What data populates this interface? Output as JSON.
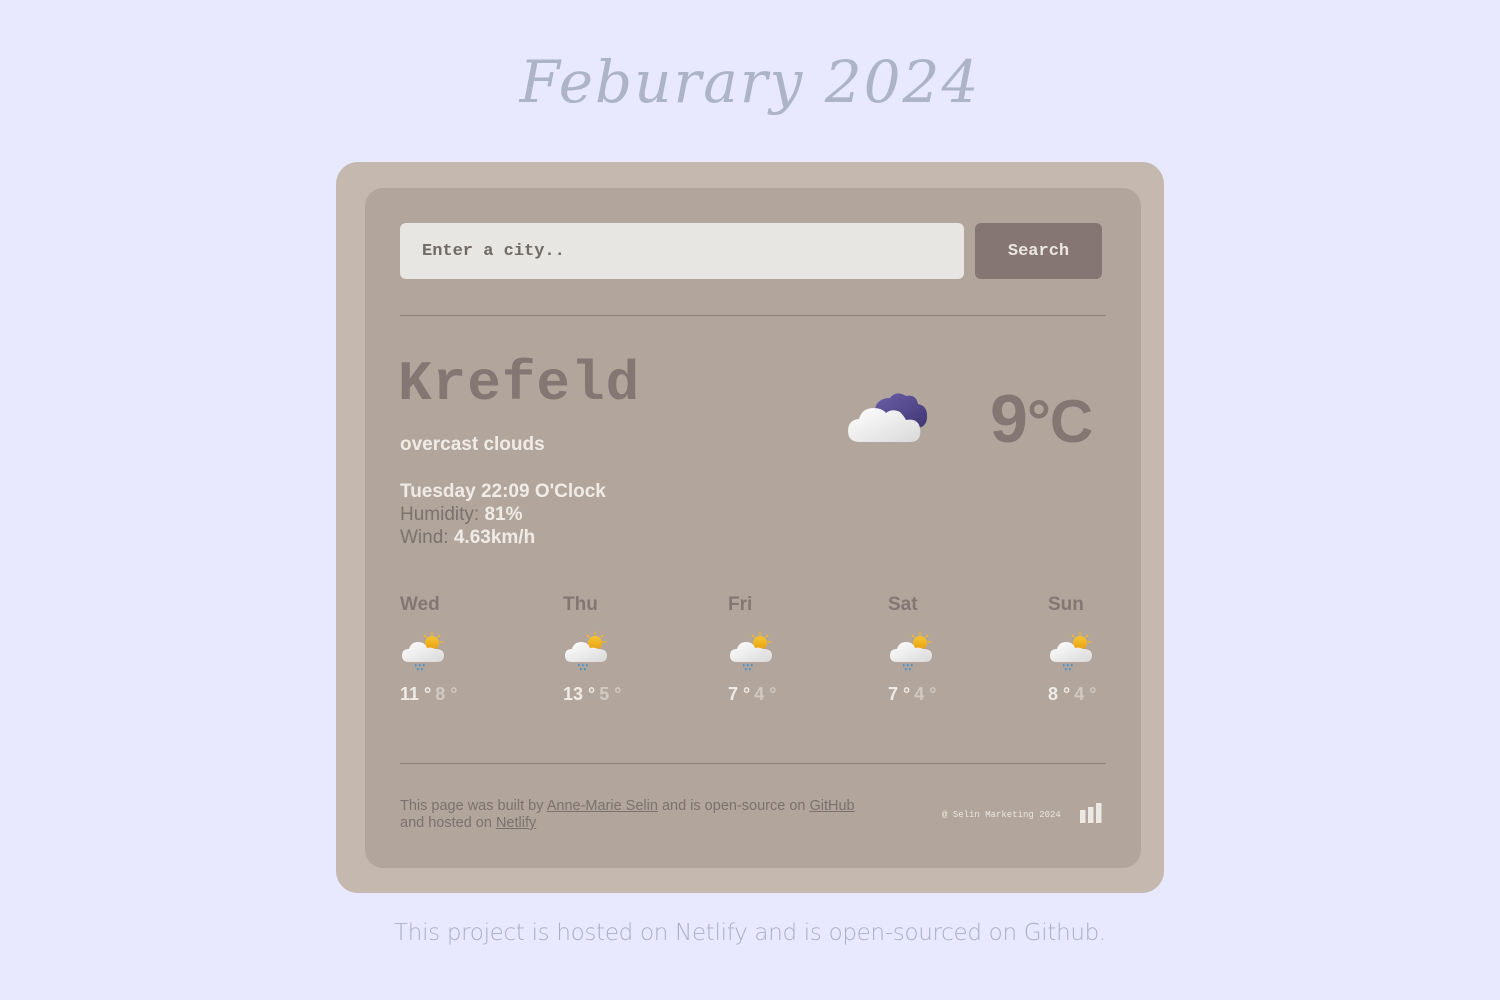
{
  "header": {
    "title": "Feburary 2024"
  },
  "search": {
    "placeholder": "Enter a city..",
    "value": "",
    "button_label": "Search"
  },
  "current": {
    "city": "Krefeld",
    "description": "overcast clouds",
    "datetime": "Tuesday 22:09 O'Clock",
    "humidity_label": "Humidity: ",
    "humidity_value": "81%",
    "wind_label": "Wind: ",
    "wind_value": "4.63km/h",
    "icon": "overcast-clouds-icon",
    "temperature": "9",
    "unit": "°C"
  },
  "forecast": [
    {
      "day": "Wed",
      "icon": "sun-cloud-rain-icon",
      "max": "11 °",
      "min": "8 °"
    },
    {
      "day": "Thu",
      "icon": "sun-cloud-rain-icon",
      "max": "13 °",
      "min": "5 °"
    },
    {
      "day": "Fri",
      "icon": "sun-cloud-rain-icon",
      "max": "7 °",
      "min": "4 °"
    },
    {
      "day": "Sat",
      "icon": "sun-cloud-rain-icon",
      "max": "7 °",
      "min": "4 °"
    },
    {
      "day": "Sun",
      "icon": "sun-cloud-rain-icon",
      "max": "8 °",
      "min": "4 °"
    }
  ],
  "footer": {
    "text_1": "This page was built by ",
    "author_link": "Anne-Marie Selin",
    "text_2": " and is open-source on ",
    "github_link": "GitHub",
    "text_3": " and hosted on ",
    "netlify_link": "Netlify",
    "copyright": "@ Selin Marketing 2024",
    "logo_icon": "bar-chart-icon"
  },
  "bottom_note": "This project is hosted on Netlify and is open-sourced on Github.",
  "colors": {
    "page_bg": "#e8e8fe",
    "outer_card": "#c5b8ae",
    "inner_card": "#b2a69c",
    "button": "#857573",
    "text_dark": "#847673",
    "text_light": "#f0ebe6"
  }
}
